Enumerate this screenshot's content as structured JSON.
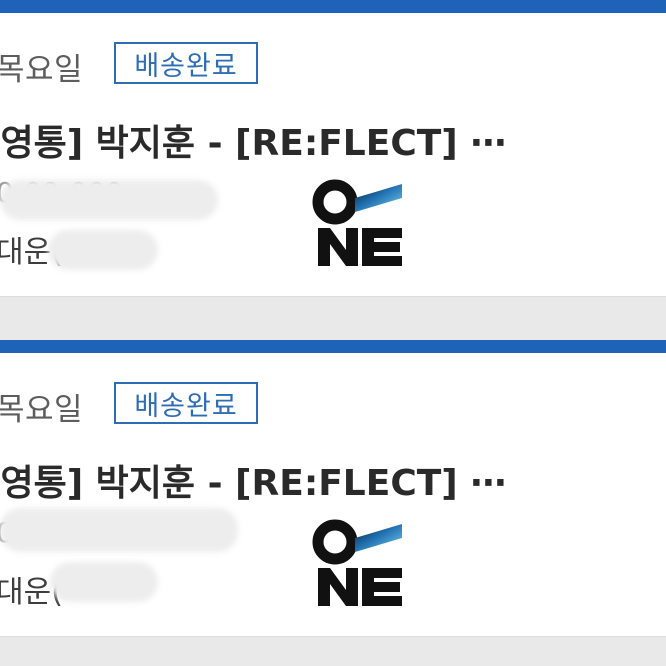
{
  "orders": [
    {
      "day": "목요일",
      "status": "배송완료",
      "title": "[영통] 박지훈 - [RE:FLECT] ⋯",
      "line2": "0-00-000",
      "line3": "대운(",
      "logo": "one-logo"
    },
    {
      "day": "목요일",
      "status": "배송완료",
      "title": "[영통] 박지훈 - [RE:FLECT] ⋯",
      "line2": "0-00-000",
      "line3": "대운(",
      "logo": "one-logo"
    }
  ],
  "colors": {
    "accent_bar": "#1e63b8",
    "badge": "#2e6db4",
    "page_bg": "#e9e9e9"
  }
}
